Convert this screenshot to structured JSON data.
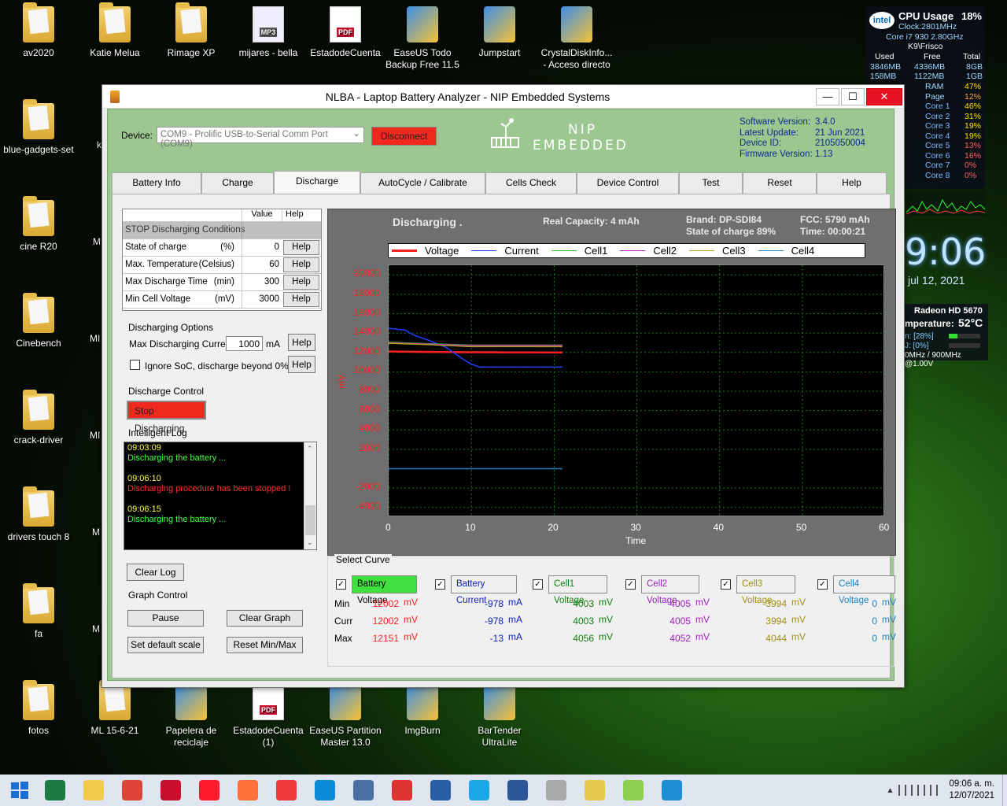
{
  "desktop": {
    "icons": [
      {
        "label": "av2020",
        "x": "f"
      },
      {
        "label": "Katie Melua",
        "x": "f"
      },
      {
        "label": "Rimage XP",
        "x": "f"
      },
      {
        "label": "mijares - bella",
        "x": "m"
      },
      {
        "label": "EstadodeCuenta",
        "x": "p"
      },
      {
        "label": "EaseUS Todo Backup Free 11.5",
        "x": "a"
      },
      {
        "label": "Jumpstart",
        "x": "a"
      },
      {
        "label": "CrystalDiskInfo... - Acceso directo",
        "x": "a"
      },
      {
        "label": "blue-gadgets-set",
        "x": "f"
      },
      {
        "label": "cine R20",
        "x": "f"
      },
      {
        "label": "Cinebench",
        "x": "f"
      },
      {
        "label": "crack-driver",
        "x": "f"
      },
      {
        "label": "drivers touch 8",
        "x": "f"
      },
      {
        "label": "fa",
        "x": "f"
      },
      {
        "label": "fotos",
        "x": "f"
      },
      {
        "label": "ML 15-6-21",
        "x": "f"
      },
      {
        "label": "Papelera de reciclaje",
        "x": "a"
      },
      {
        "label": "EstadodeCuenta (1)",
        "x": "p"
      },
      {
        "label": "EaseUS Partition Master 13.0",
        "x": "a"
      },
      {
        "label": "ImgBurn",
        "x": "a"
      },
      {
        "label": "BarTender UltraLite",
        "x": "a"
      }
    ],
    "partial_labels": [
      "k",
      "M",
      "MI",
      "MI",
      "M",
      "M"
    ],
    "mp3_tag": "MP3",
    "pdf_tag": "PDF"
  },
  "cpu_gadget": {
    "brand": "intel",
    "title": "CPU Usage",
    "percent": "18%",
    "clock": "Clock:2801MHz",
    "model": "Core i7 930 2.80GHz",
    "host": "K9\\Frisco",
    "headers": [
      "Used",
      "Free",
      "Total"
    ],
    "mem": [
      [
        "3846MB",
        "4336MB",
        "8GB"
      ],
      [
        "158MB",
        "1122MB",
        "1GB"
      ]
    ],
    "rows": [
      [
        "RAM",
        "47%"
      ],
      [
        "Page",
        "12%"
      ],
      [
        "Core 1",
        "46%"
      ],
      [
        "Core 2",
        "31%"
      ],
      [
        "Core 3",
        "19%"
      ],
      [
        "Core 4",
        "19%"
      ],
      [
        "Core 5",
        "13%"
      ],
      [
        "Core 6",
        "16%"
      ],
      [
        "Core 7",
        "0%"
      ],
      [
        "Core 8",
        "0%"
      ]
    ]
  },
  "clock_gadget": {
    "time": "9:06",
    "date": "jul 12, 2021"
  },
  "gpu_gadget": {
    "name": "Radeon HD 5670",
    "temp_label": "mperature:",
    "temp": "52°C",
    "l1": "n: [28%]",
    "l2": "J: [0%]",
    "l3": "0MHz / 900MHz @1.00V"
  },
  "window": {
    "title": "NLBA - Laptop Battery Analyzer - NIP Embedded Systems",
    "min": "—",
    "max": "☐",
    "close": "✕"
  },
  "device": {
    "label": "Device:",
    "value": "COM9 - Prolific USB-to-Serial Comm Port (COM9)",
    "disconnect": "Disconnect"
  },
  "logo": {
    "line1": "NIP",
    "line2": "EMBEDDED"
  },
  "info": {
    "labels": [
      "Software Version:",
      "Latest Update:",
      "Device ID:",
      "Firmware Version:"
    ],
    "values": [
      "3.4.0",
      "21 Jun 2021",
      "2105050004",
      "1.13"
    ]
  },
  "tabs": [
    "Battery Info",
    "Charge",
    "Discharge",
    "AutoCycle / Calibrate",
    "Cells Check",
    "Device Control",
    "Test",
    "Reset",
    "Help"
  ],
  "conditions": {
    "col_value": "Value",
    "col_help": "Help",
    "header": "STOP Discharging Conditions",
    "rows": [
      {
        "name": "State of charge",
        "unit": "(%)",
        "value": "0",
        "help": "Help"
      },
      {
        "name": "Max. Temperature",
        "unit": "(Celsius)",
        "value": "60",
        "help": "Help"
      },
      {
        "name": "Max Discharge Time",
        "unit": "(min)",
        "value": "300",
        "help": "Help"
      },
      {
        "name": "Min Cell Voltage",
        "unit": "(mV)",
        "value": "3000",
        "help": "Help"
      }
    ]
  },
  "options": {
    "title": "Discharging Options",
    "max_label": "Max Discharging Current:",
    "max_value": "1000",
    "unit": "mA",
    "help": "Help",
    "ignore_label": "Ignore SoC, discharge beyond 0%",
    "help2": "Help"
  },
  "control": {
    "title": "Discharge Control",
    "stop": "Stop Discharging"
  },
  "log": {
    "title": "Intelligent Log",
    "entries": [
      {
        "time": "09:03:09",
        "msg": "Discharging the battery ...",
        "color": "#40ff40"
      },
      {
        "time": "09:06:10",
        "msg": "Discharging procedure has been stopped !",
        "color": "#ff3030"
      },
      {
        "time": "09:06:15",
        "msg": "Discharging the battery ...",
        "color": "#40ff40"
      }
    ],
    "clear": "Clear Log"
  },
  "graph_control": {
    "title": "Graph Control",
    "pause": "Pause",
    "clear": "Clear Graph",
    "default": "Set default scale",
    "reset": "Reset Min/Max"
  },
  "chart_header": {
    "status": "Discharging .",
    "capacity": "Real Capacity:  4 mAh",
    "brand": "Brand:  DP-SDI84",
    "soc": "State of charge  89%",
    "fcc": "FCC:  5790 mAh",
    "time": "Time:  00:00:21"
  },
  "chart_data": {
    "type": "line",
    "xlabel": "Time",
    "ylabel": "mV",
    "xlim": [
      0,
      60
    ],
    "ylim": [
      -5000,
      21000
    ],
    "xticks": [
      0,
      10,
      20,
      30,
      40,
      50,
      60
    ],
    "yticks": [
      20000,
      18000,
      16000,
      14000,
      12000,
      10000,
      8000,
      6000,
      4000,
      2000,
      -2000,
      -4000
    ],
    "series": [
      {
        "name": "Voltage",
        "color": "#ff2020",
        "points": [
          [
            0,
            12100
          ],
          [
            5,
            12050
          ],
          [
            10,
            12020
          ],
          [
            21,
            12002
          ]
        ]
      },
      {
        "name": "Current",
        "color": "#2040ff",
        "points": [
          [
            0,
            14500
          ],
          [
            2,
            14300
          ],
          [
            3,
            13800
          ],
          [
            5,
            13200
          ],
          [
            7,
            12500
          ],
          [
            8,
            11900
          ],
          [
            9,
            11300
          ],
          [
            10,
            10800
          ],
          [
            11,
            10500
          ],
          [
            21,
            10500
          ]
        ]
      },
      {
        "name": "Cell1",
        "color": "#30c030",
        "points": [
          [
            0,
            13050
          ],
          [
            5,
            12900
          ],
          [
            10,
            12750
          ],
          [
            21,
            12750
          ]
        ]
      },
      {
        "name": "Cell2",
        "color": "#c020c0",
        "points": [
          [
            0,
            13000
          ],
          [
            5,
            12850
          ],
          [
            10,
            12700
          ],
          [
            21,
            12700
          ]
        ]
      },
      {
        "name": "Cell3",
        "color": "#b0a020",
        "points": [
          [
            0,
            12950
          ],
          [
            5,
            12800
          ],
          [
            10,
            12600
          ],
          [
            21,
            12600
          ]
        ]
      },
      {
        "name": "Cell4",
        "color": "#2080c0",
        "points": [
          [
            0,
            0
          ],
          [
            21,
            0
          ]
        ]
      }
    ]
  },
  "select_curve": {
    "title": "Select Curve",
    "row_labels": [
      "Min",
      "Curr",
      "Max"
    ],
    "curves": [
      {
        "label": "Battery Voltage",
        "bg": "#40e040",
        "fg": "#000",
        "vc": "#ff2020",
        "unit": "mV",
        "min": "12002",
        "curr": "12002",
        "max": "12151"
      },
      {
        "label": "Battery Current",
        "bg": "#f0f0f0",
        "fg": "#1020c0",
        "vc": "#1020c0",
        "unit": "mA",
        "min": "-978",
        "curr": "-978",
        "max": "-13"
      },
      {
        "label": "Cell1 Voltage",
        "bg": "#f0f0f0",
        "fg": "#108010",
        "vc": "#108010",
        "unit": "mV",
        "min": "4003",
        "curr": "4003",
        "max": "4056"
      },
      {
        "label": "Cell2 Voltage",
        "bg": "#f0f0f0",
        "fg": "#a020c0",
        "vc": "#a020c0",
        "unit": "mV",
        "min": "4005",
        "curr": "4005",
        "max": "4052"
      },
      {
        "label": "Cell3 Voltage",
        "bg": "#f0f0f0",
        "fg": "#a09010",
        "vc": "#a09010",
        "unit": "mV",
        "min": "3994",
        "curr": "3994",
        "max": "4044"
      },
      {
        "label": "Cell4 Voltage",
        "bg": "#f0f0f0",
        "fg": "#2080c0",
        "vc": "#2080c0",
        "unit": "mV",
        "min": "0",
        "curr": "0",
        "max": "0"
      }
    ]
  },
  "taskbar": {
    "time": "09:06 a. m.",
    "date": "12/07/2021",
    "tray": "▲"
  }
}
